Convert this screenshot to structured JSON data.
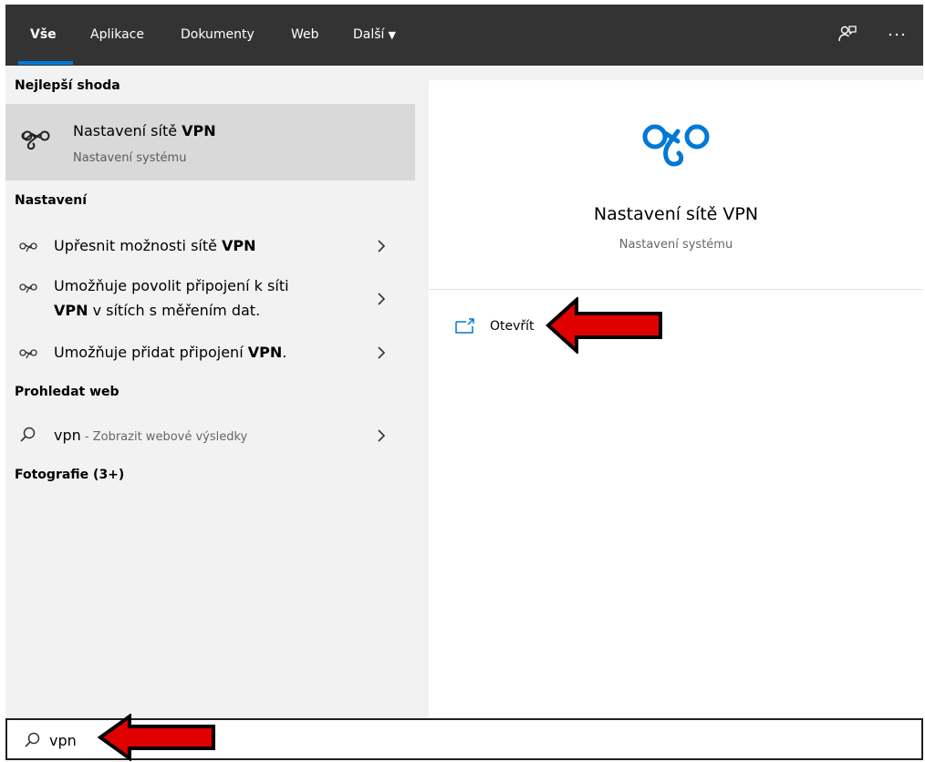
{
  "tabs": [
    {
      "label": "Vše"
    },
    {
      "label": "Aplikace"
    },
    {
      "label": "Dokumenty"
    },
    {
      "label": "Web"
    },
    {
      "label": "Další"
    }
  ],
  "groups": {
    "best_match": "Nejlepší shoda",
    "settings": "Nastavení",
    "web": "Prohledat web",
    "photos": "Fotografie (3+)"
  },
  "best_match": {
    "title_prefix": "Nastavení sítě ",
    "title_bold": "VPN",
    "subtitle": "Nastavení systému"
  },
  "settings_items": [
    {
      "pre": "Upřesnit možnosti sítě ",
      "bold": "VPN"
    },
    {
      "line1": "Umožňuje povolit připojení k síti",
      "bold": "VPN",
      "line2_rest": " v sítích s měřením dat."
    },
    {
      "pre": "Umožňuje přidat připojení ",
      "bold": "VPN",
      "post": "."
    }
  ],
  "web_item": {
    "query": "vpn",
    "suffix": " - Zobrazit webové výsledky"
  },
  "detail": {
    "title": "Nastavení sítě VPN",
    "subtitle": "Nastavení systému",
    "open_label": "Otevřít"
  },
  "search": {
    "value": "vpn"
  },
  "colors": {
    "accent": "#0078d7",
    "arrow_fill": "#e00000",
    "topbar": "#333333"
  }
}
